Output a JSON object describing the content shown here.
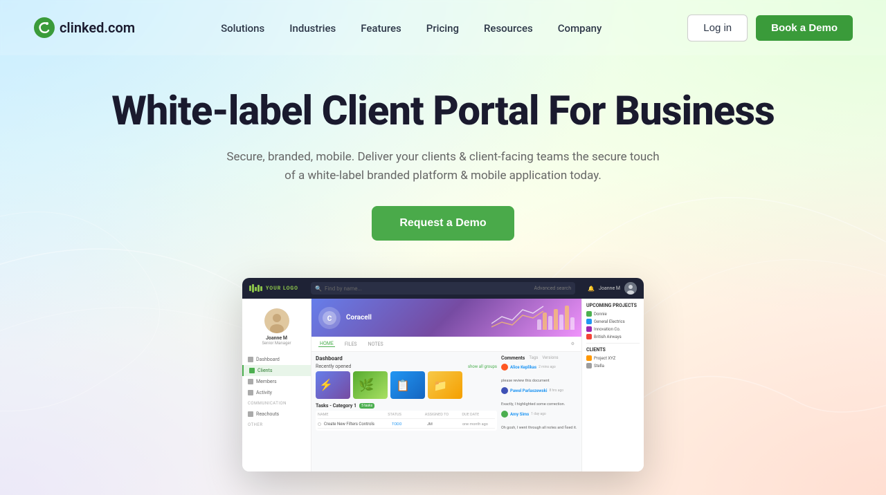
{
  "meta": {
    "title": "Clinked - White-label Client Portal For Business"
  },
  "brand": {
    "logo_text": "clinked.com",
    "logo_icon": "C"
  },
  "nav": {
    "links": [
      {
        "id": "solutions",
        "label": "Solutions"
      },
      {
        "id": "industries",
        "label": "Industries"
      },
      {
        "id": "features",
        "label": "Features"
      },
      {
        "id": "pricing",
        "label": "Pricing"
      },
      {
        "id": "resources",
        "label": "Resources"
      },
      {
        "id": "company",
        "label": "Company"
      }
    ],
    "login_label": "Log in",
    "demo_label": "Book a Demo"
  },
  "hero": {
    "title": "White-label Client Portal For Business",
    "subtitle": "Secure, branded, mobile. Deliver your clients & client-facing teams the secure touch of a white-label branded platform & mobile application today.",
    "cta_label": "Request a Demo"
  },
  "dashboard": {
    "topbar": {
      "logo": "YOUR LOGO",
      "search_placeholder": "Find by name...",
      "advanced_search": "Advanced search",
      "user_name": "Joanne M"
    },
    "sidebar": {
      "user_name": "Joanne M",
      "user_role": "Senior Manager",
      "nav_items": [
        {
          "label": "Dashboard",
          "active": false
        },
        {
          "label": "Clients",
          "active": true
        },
        {
          "label": "Members",
          "active": false
        },
        {
          "label": "Activity",
          "active": false
        }
      ],
      "section_label": "COMMUNICATION",
      "nav_items2": [
        {
          "label": "Reachouts",
          "active": false
        }
      ],
      "section_label2": "OTHER"
    },
    "client": {
      "name": "Coracell",
      "tabs": [
        "HOME",
        "FILES",
        "NOTES"
      ],
      "active_tab": "HOME"
    },
    "dashboard_section": {
      "title": "Dashboard",
      "recently_opened_label": "Recently opened",
      "show_all": "show all groups",
      "files": [
        {
          "color": "purple",
          "type": "doc"
        },
        {
          "color": "green",
          "type": "sheet"
        },
        {
          "color": "blue",
          "type": "folder"
        },
        {
          "color": "yellow",
          "type": "image"
        }
      ]
    },
    "tasks": {
      "title": "Tasks - Category 1",
      "badge": "5 tasks",
      "items": [
        {
          "text": "Create New Filters Controls",
          "status": "TODO",
          "assigned": "JM",
          "date": "one month ago"
        }
      ]
    },
    "comments": {
      "title": "Comments",
      "items": [
        {
          "name": "Alice Keplikas",
          "time": "2 mins ago",
          "text": "please review this document"
        },
        {
          "name": "Pawel Parlaszewski",
          "time": "8 hrs ago",
          "text": "Exactly, I highlighted some correction."
        },
        {
          "name": "Amy Sims",
          "time": "1 day ago",
          "text": "Oh gosh, I went through all notes and fixed it."
        }
      ]
    },
    "upcoming_projects": {
      "title": "UPCOMING PROJECTS",
      "items": [
        {
          "label": "Donnie",
          "color": "#4caf50"
        },
        {
          "label": "General Electrics",
          "color": "#2196F3"
        },
        {
          "label": "Innovation Co.",
          "color": "#9c27b0"
        },
        {
          "label": "British Airways",
          "color": "#f44336"
        }
      ]
    },
    "clients_list": {
      "title": "CLIENTS",
      "items": [
        {
          "label": "Project XYZ",
          "color": "#ff9800"
        },
        {
          "label": "Stella",
          "color": "#9e9e9e"
        }
      ]
    }
  },
  "colors": {
    "green_primary": "#3a9b3a",
    "green_cta": "#4aaa4a",
    "nav_text": "#2d3748",
    "hero_title": "#1a1a2e",
    "hero_subtitle": "#666666"
  }
}
